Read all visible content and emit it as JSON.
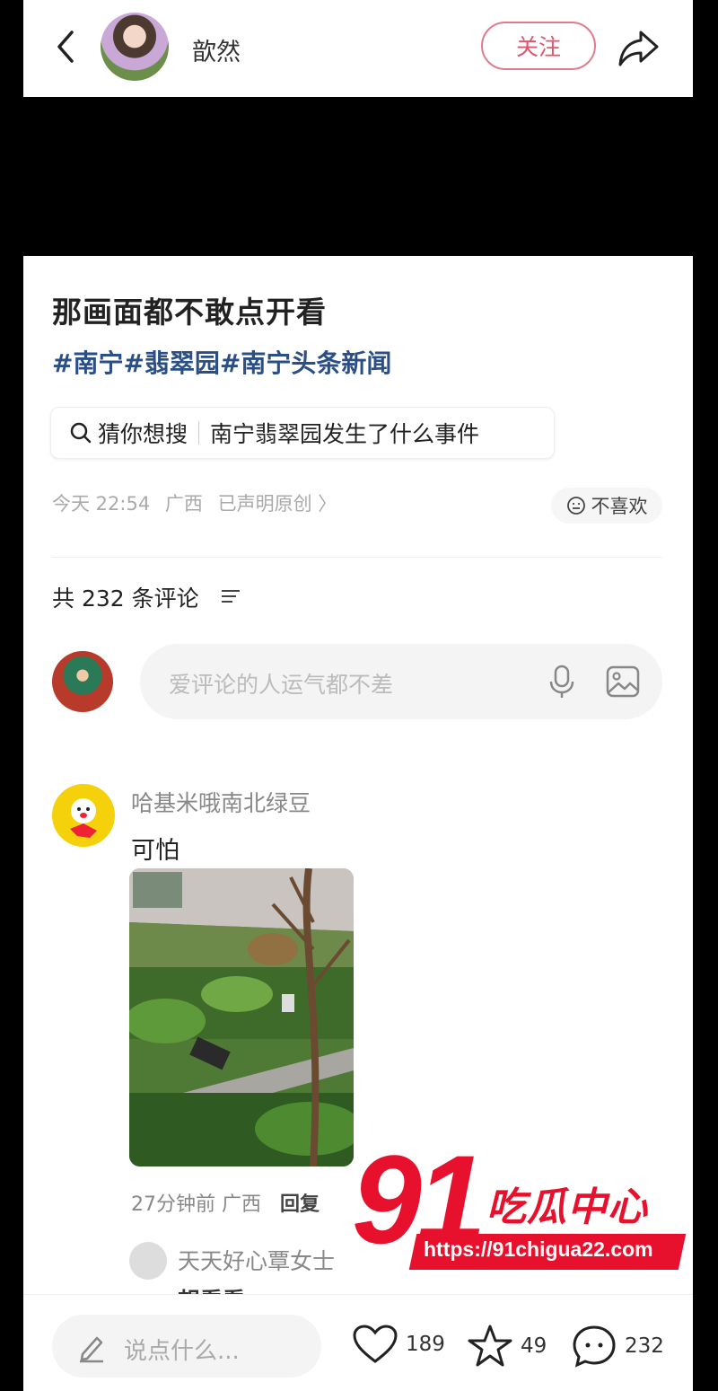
{
  "header": {
    "author_name": "歆然",
    "follow_label": "关注"
  },
  "post": {
    "title": "那画面都不敢点开看",
    "hashtags": "#南宁#翡翠园#南宁头条新闻",
    "search_prefix": "猜你想搜",
    "search_term": "南宁翡翠园发生了什么事件",
    "time": "今天 22:54",
    "location": "广西",
    "original_label": "已声明原创 〉",
    "dislike_label": "不喜欢"
  },
  "comments": {
    "count_label": "共 232 条评论",
    "input_placeholder": "爱评论的人运气都不差",
    "items": [
      {
        "name": "哈基米哦南北绿豆",
        "text": "可怕",
        "time": "27分钟前",
        "location": "广西",
        "reply_label": "回复",
        "sub_reply": {
          "name": "天天好心覃女士",
          "text": "想看看"
        }
      }
    ]
  },
  "bottom_bar": {
    "say_placeholder": "说点什么...",
    "likes": "189",
    "stars": "49",
    "comments": "232"
  },
  "watermark": {
    "number": "91",
    "brand": "吃瓜中心",
    "url": "https://91chigua22.com"
  }
}
